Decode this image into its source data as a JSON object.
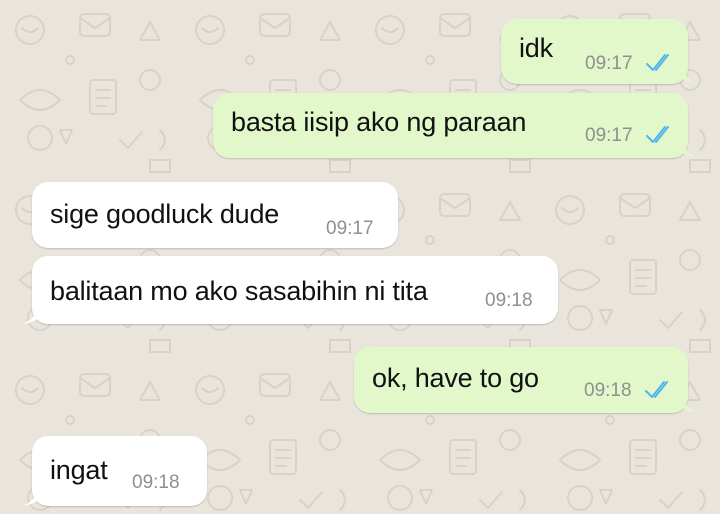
{
  "colors": {
    "outgoing_bubble": "#e2f8cb",
    "incoming_bubble": "#ffffff",
    "read_ticks": "#4fb6ec",
    "timestamp": "#8f8f8f",
    "wallpaper": "#e9e5dd"
  },
  "messages": [
    {
      "direction": "outgoing",
      "text": "idk",
      "time": "09:17",
      "status": "read",
      "status_icon": "double-check-icon"
    },
    {
      "direction": "outgoing",
      "text": "basta iisip ako ng paraan",
      "time": "09:17",
      "status": "read",
      "status_icon": "double-check-icon"
    },
    {
      "direction": "incoming",
      "text": "sige goodluck dude",
      "time": "09:17"
    },
    {
      "direction": "incoming",
      "text": "balitaan mo ako sasabihin ni tita",
      "time": "09:18"
    },
    {
      "direction": "outgoing",
      "text": "ok, have to go",
      "time": "09:18",
      "status": "read",
      "status_icon": "double-check-icon"
    },
    {
      "direction": "incoming",
      "text": "ingat",
      "time": "09:18"
    }
  ]
}
